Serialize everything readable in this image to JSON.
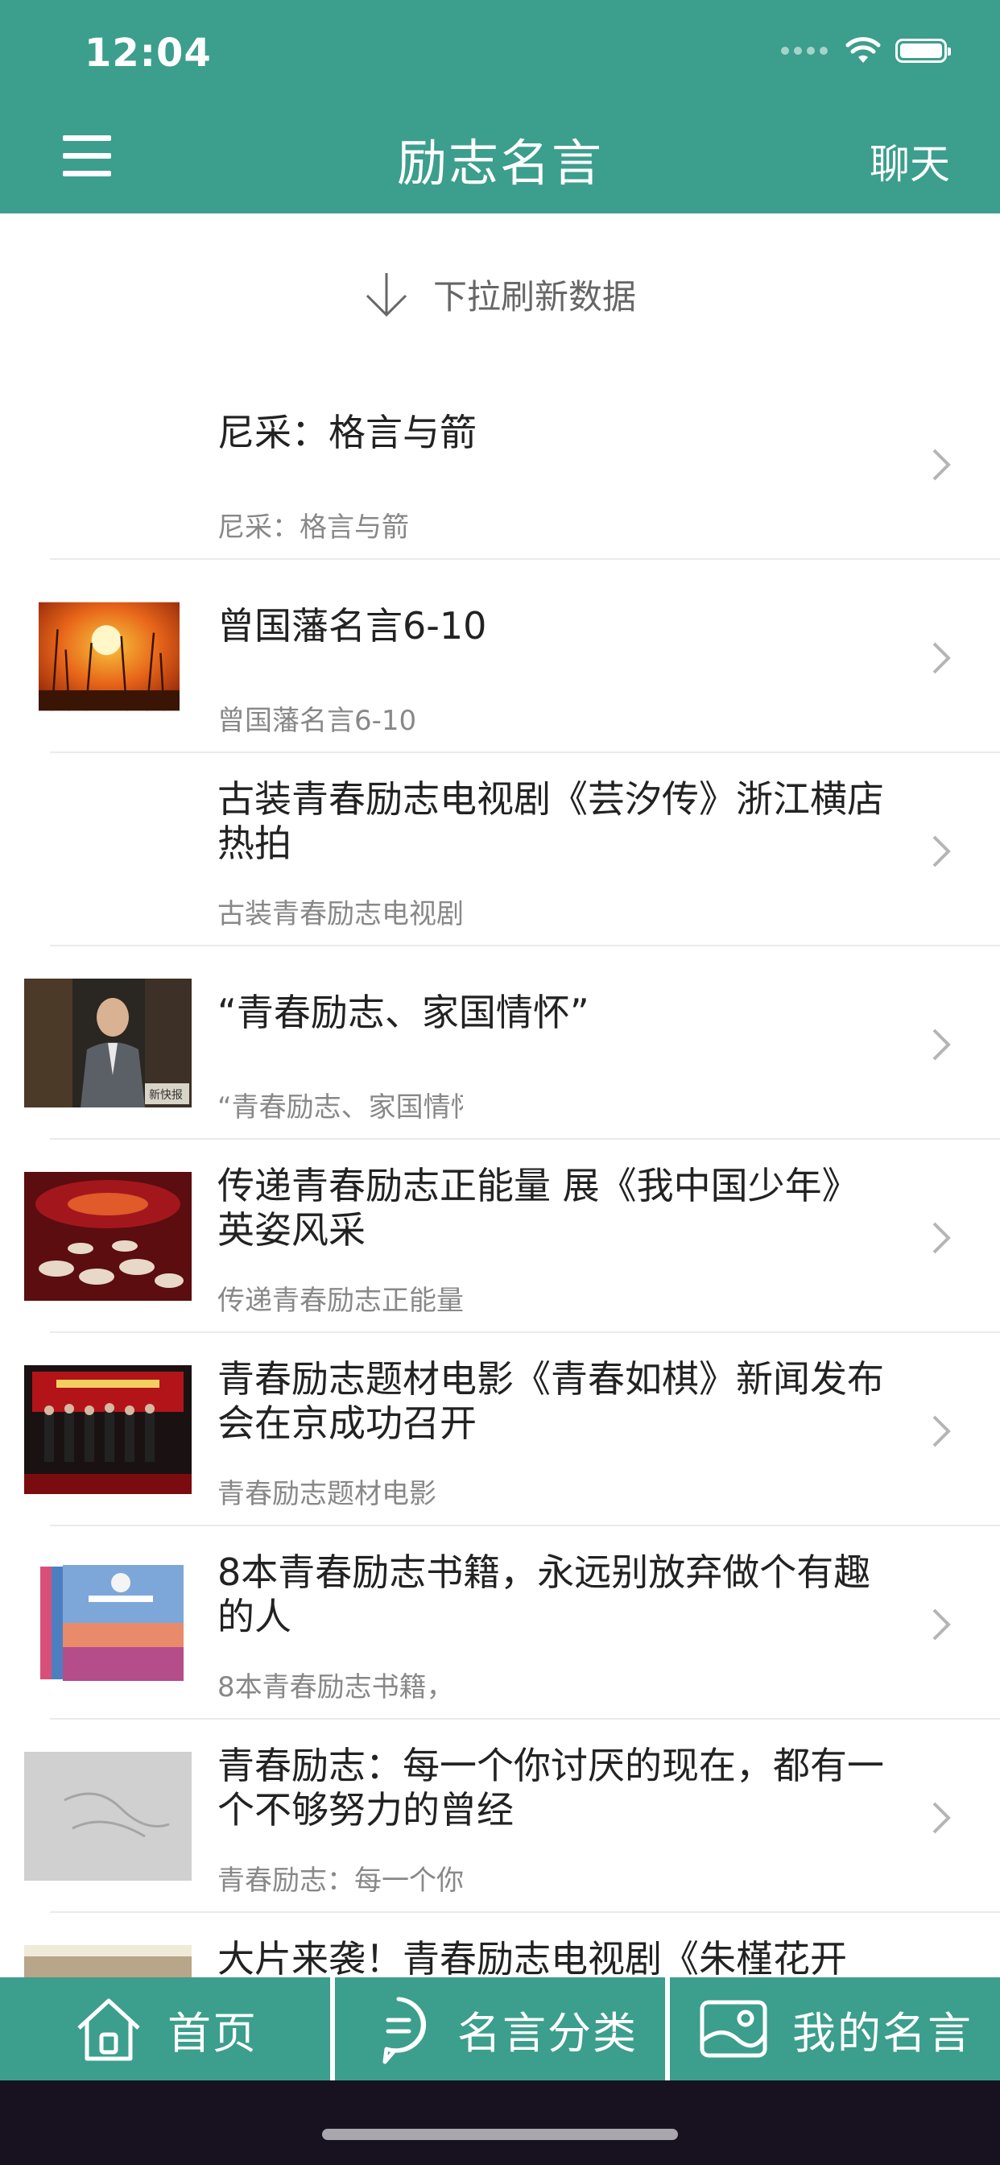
{
  "status_bar": {
    "time": "12:04"
  },
  "header": {
    "title": "励志名言",
    "chat_label": "聊天"
  },
  "refresh": {
    "text": "下拉刷新数据"
  },
  "list": [
    {
      "title": "尼采：格言与箭",
      "subtitle": "尼采：格言与箭",
      "thumb": "none"
    },
    {
      "title": "曾国藩名言6-10",
      "subtitle": "曾国藩名言6-10",
      "thumb": "sunset"
    },
    {
      "title": "古装青春励志电视剧《芸汐传》浙江横店热拍",
      "subtitle": "古装青春励志电视剧",
      "thumb": "none"
    },
    {
      "title": "“青春励志、家国情怀”",
      "subtitle": "“青春励志、家国情怀”",
      "thumb": "man-suit"
    },
    {
      "title": "传递青春励志正能量 展《我中国少年》英姿风采",
      "subtitle": "传递青春励志正能量",
      "thumb": "stage-red"
    },
    {
      "title": "青春励志题材电影《青春如棋》新闻发布会在京成功召开",
      "subtitle": "青春励志题材电影",
      "thumb": "press-event"
    },
    {
      "title": "8本青春励志书籍，永远别放弃做个有趣的人",
      "subtitle": "8本青春励志书籍，",
      "thumb": "books"
    },
    {
      "title": "青春励志：每一个你讨厌的现在，都有一个不够努力的曾经",
      "subtitle": "青春励志：每一个你讨厌的现在",
      "thumb": "paper"
    },
    {
      "title": "大片来袭！青春励志电视剧《朱槿花开",
      "subtitle": "",
      "thumb": "partial"
    }
  ],
  "tabbar": {
    "tabs": [
      {
        "label": "首页",
        "icon": "home-icon"
      },
      {
        "label": "名言分类",
        "icon": "chat-bubble-icon"
      },
      {
        "label": "我的名言",
        "icon": "image-icon"
      }
    ]
  },
  "colors": {
    "primary": "#3c9e8d",
    "text": "#222222",
    "subtext": "#888888"
  }
}
